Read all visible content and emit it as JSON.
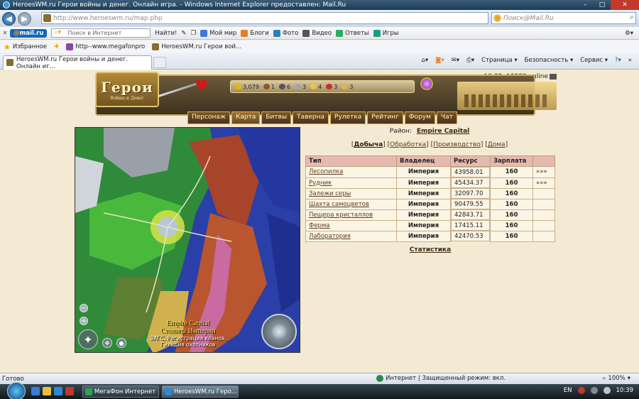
{
  "window": {
    "title": "HeroesWM.ru Герои войны и денег. Онлайн игра. - Windows Internet Explorer предоставлен: Mail.Ru"
  },
  "address": {
    "url": "http://www.heroeswm.ru/map.php",
    "search_placeholder": "Поиск@Mail.Ru"
  },
  "toolbar": {
    "mail_brand_at": "@",
    "mail_brand": "mail.ru",
    "search_placeholder": "Поиск в Интернет",
    "find_label": "Найти!",
    "items": [
      "Мой мир",
      "Блоги",
      "Фото",
      "Видео",
      "Ответы",
      "Игры"
    ]
  },
  "favorites": {
    "label": "Избранное",
    "items": [
      "http--www.megafonpro",
      "HeroesWM.ru Герои вой..."
    ]
  },
  "tab": {
    "title": "HeroesWM.ru Герои войны и денег. Онлайн иг..."
  },
  "commandbar": {
    "page": "Страница",
    "safety": "Безопасность",
    "service": "Сервис"
  },
  "game": {
    "online_text": "10:39, 10282 online",
    "logo_big": "Герои",
    "logo_small": "Войны и Денег",
    "resources": [
      "3,079",
      "1",
      "6",
      "3",
      "4",
      "3",
      "3"
    ],
    "menu": [
      "Персонаж",
      "Карта",
      "Битвы",
      "Таверна",
      "Рулетка",
      "Рейтинг",
      "Форум",
      "Чат"
    ],
    "active_menu": "Карта",
    "map": {
      "caption_en": "Empire Capital",
      "caption_ru": "Столица Империи",
      "line3": "ЗАГС, Регистрация кланов,",
      "line4": "Гильдия охотников"
    },
    "district_label": "Район:",
    "district_name": "Empire Capital",
    "subtabs": [
      "Добыча",
      "Обработка",
      "Производство",
      "Дома"
    ],
    "table": {
      "headers": [
        "Тип",
        "Владелец",
        "Ресурс",
        "Зарплата",
        ""
      ],
      "rows": [
        {
          "name": "Лесопилка",
          "owner": "Империя",
          "resource": "43958.01",
          "salary": "160",
          "more": "»»»"
        },
        {
          "name": "Рудник",
          "owner": "Империя",
          "resource": "45434.37",
          "salary": "160",
          "more": "»»»"
        },
        {
          "name": "Залежи серы",
          "owner": "Империя",
          "resource": "32097.70",
          "salary": "160",
          "more": ""
        },
        {
          "name": "Шахта самоцветов",
          "owner": "Империя",
          "resource": "90479.55",
          "salary": "160",
          "more": ""
        },
        {
          "name": "Пещера кристаллов",
          "owner": "Империя",
          "resource": "42843.71",
          "salary": "160",
          "more": ""
        },
        {
          "name": "Ферма",
          "owner": "Империя",
          "resource": "17415.11",
          "salary": "160",
          "more": ""
        },
        {
          "name": "Лаборатория",
          "owner": "Империя",
          "resource": "42470.53",
          "salary": "160",
          "more": ""
        }
      ]
    },
    "stats_link": "Статистика"
  },
  "status": {
    "ready": "Готово",
    "zone": "Интернет | Защищенный режим: вкл.",
    "zoom": "100%"
  },
  "taskbar": {
    "buttons": [
      "МегаФон Интернет",
      "HeroesWM.ru Геро..."
    ],
    "lang": "EN",
    "clock": "10:39"
  }
}
